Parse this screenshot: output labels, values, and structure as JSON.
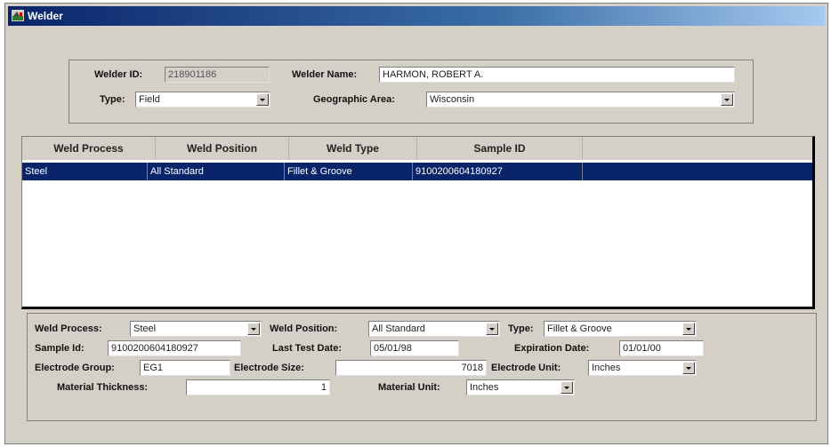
{
  "window": {
    "title": "Welder"
  },
  "header": {
    "welder_id_label": "Welder ID:",
    "welder_id_value": "218901186",
    "welder_name_label": "Welder Name:",
    "welder_name_value": "HARMON, ROBERT A.",
    "type_label": "Type:",
    "type_value": "Field",
    "geo_label": "Geographic Area:",
    "geo_value": "Wisconsin"
  },
  "grid": {
    "columns": [
      "Weld Process",
      "Weld Position",
      "Weld Type",
      "Sample ID"
    ],
    "rows": [
      {
        "weld_process": "Steel",
        "weld_position": "All Standard",
        "weld_type": "Fillet & Groove",
        "sample_id": "9100200604180927",
        "selected": true
      }
    ]
  },
  "detail": {
    "weld_process_label": "Weld Process:",
    "weld_process_value": "Steel",
    "weld_position_label": "Weld Position:",
    "weld_position_value": "All Standard",
    "type_label": "Type:",
    "type_value": "Fillet & Groove",
    "sample_id_label": "Sample Id:",
    "sample_id_value": "9100200604180927",
    "last_test_label": "Last Test Date:",
    "last_test_value": "05/01/98",
    "expiration_label": "Expiration Date:",
    "expiration_value": "01/01/00",
    "electrode_group_label": "Electrode Group:",
    "electrode_group_value": "EG1",
    "electrode_size_label": "Electrode Size:",
    "electrode_size_value": "7018",
    "electrode_unit_label": "Electrode Unit:",
    "electrode_unit_value": "Inches",
    "material_thickness_label": "Material Thickness:",
    "material_thickness_value": "1",
    "material_unit_label": "Material Unit:",
    "material_unit_value": "Inches"
  },
  "colors": {
    "selection": "#0a246a",
    "face": "#d4d0c8"
  }
}
